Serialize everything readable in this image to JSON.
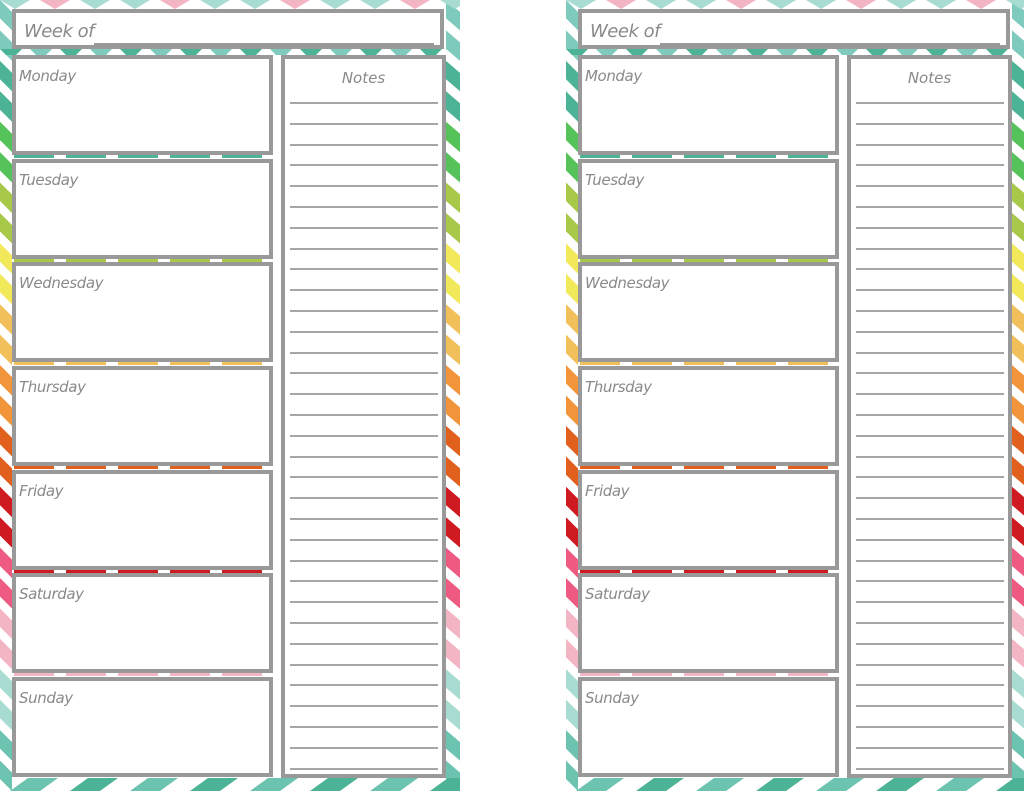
{
  "planner": {
    "week_label": "Week of",
    "notes_label": "Notes",
    "days": [
      "Monday",
      "Tuesday",
      "Wednesday",
      "Thursday",
      "Friday",
      "Saturday",
      "Sunday"
    ],
    "note_line_count": 33,
    "frame_colors": {
      "border": "#999999",
      "text": "#8a8a8a",
      "stripes": [
        "#7ecbbd",
        "#4db396",
        "#55c35a",
        "#a8c84a",
        "#f1e85a",
        "#f2c05a",
        "#f2943a",
        "#e2601e",
        "#d01a22",
        "#ee5a82",
        "#f3b4c4",
        "#a8dcd2",
        "#6cc4b0"
      ],
      "chevron_top": [
        "#a8dcd2",
        "#f3b4c4"
      ],
      "chevron_bottom": [
        "#6cc4b0",
        "#4db396"
      ]
    }
  },
  "pages": [
    {
      "id": "left"
    },
    {
      "id": "right"
    }
  ]
}
